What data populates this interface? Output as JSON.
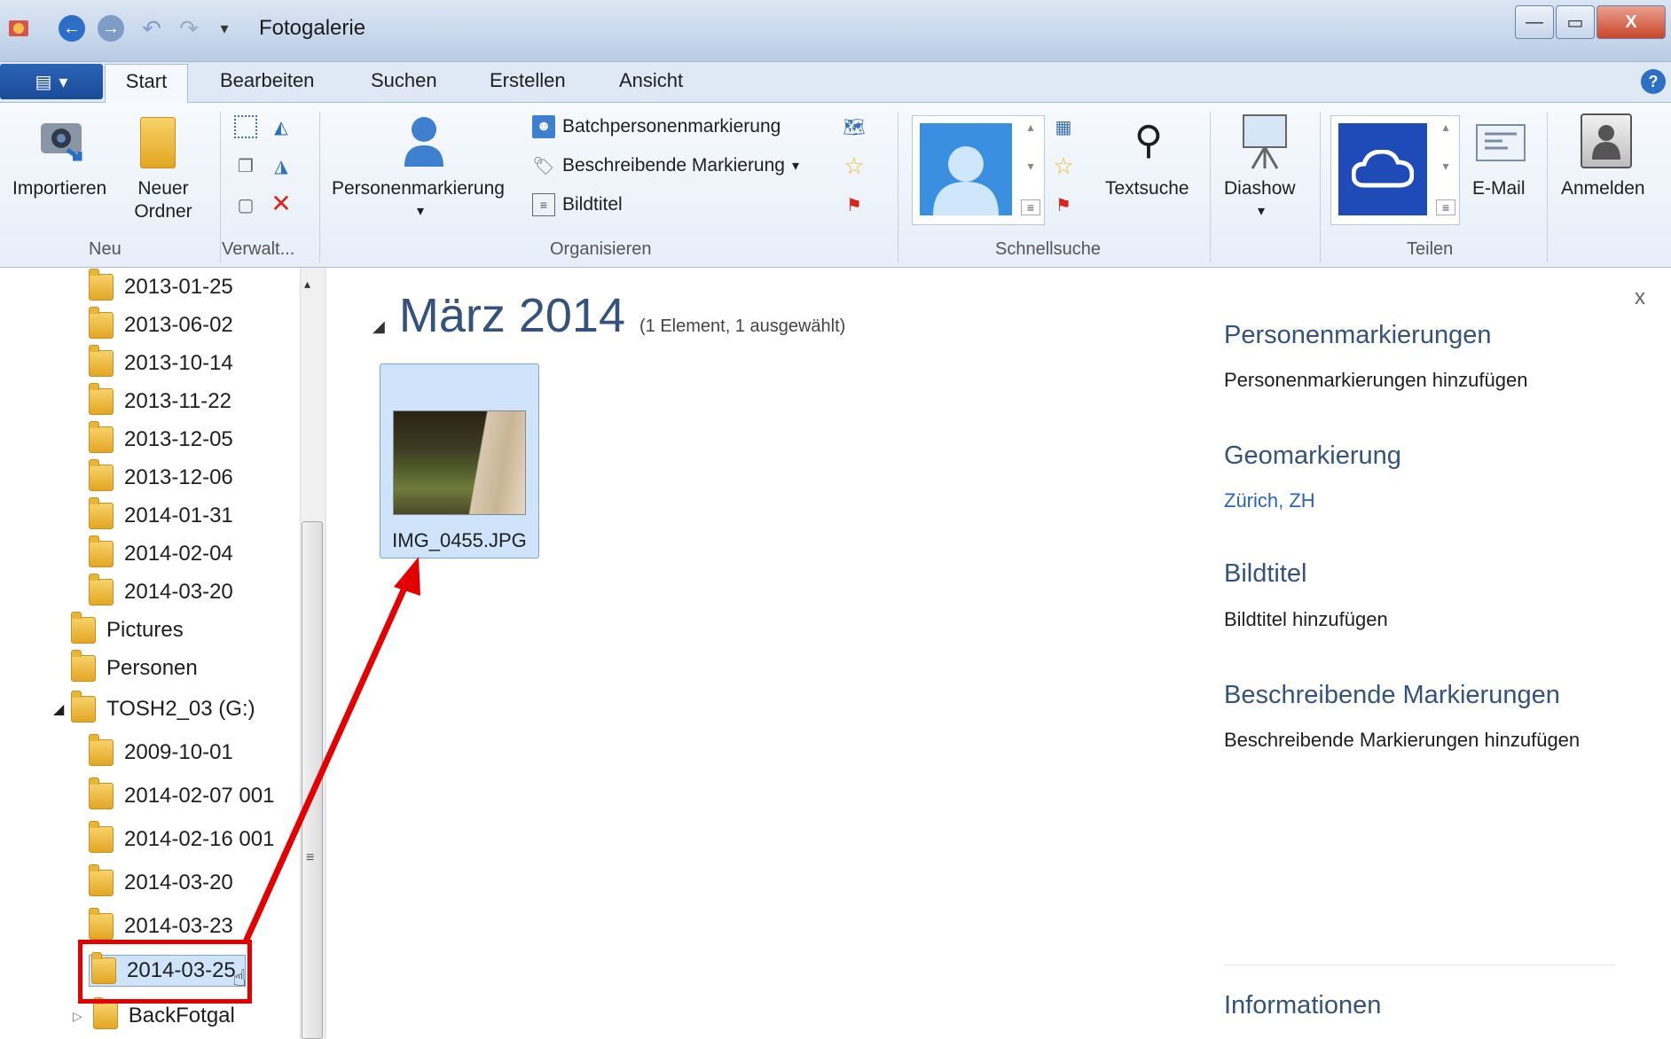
{
  "window": {
    "title": "Fotogalerie",
    "controls": {
      "minimize": "—",
      "maximize": "▭",
      "close": "X"
    }
  },
  "ribbon": {
    "app_menu_icon": "app-menu-icon",
    "tabs": [
      "Start",
      "Bearbeiten",
      "Suchen",
      "Erstellen",
      "Ansicht"
    ],
    "active_tab": "Start",
    "groups": {
      "neu": {
        "label": "Neu",
        "importieren": "Importieren",
        "neuer_ordner_1": "Neuer",
        "neuer_ordner_2": "Ordner"
      },
      "verwalten": {
        "label": "Verwalt..."
      },
      "organisieren": {
        "label": "Organisieren",
        "personenmarkierung": "Personenmarkierung",
        "batch": "Batchpersonenmarkierung",
        "beschreibende": "Beschreibende Markierung",
        "bildtitel": "Bildtitel"
      },
      "schnellsuche": {
        "label": "Schnellsuche",
        "textsuche": "Textsuche"
      },
      "diashow": {
        "label": "Diashow"
      },
      "teilen": {
        "label": "Teilen",
        "email": "E-Mail"
      },
      "anmelden": {
        "label": "Anmelden"
      }
    }
  },
  "tree": {
    "items": [
      "2013-01-25",
      "2013-06-02",
      "2013-10-14",
      "2013-11-22",
      "2013-12-05",
      "2013-12-06",
      "2014-01-31",
      "2014-02-04",
      "2014-03-20",
      "Pictures",
      "Personen",
      "TOSH2_03 (G:)",
      "2009-10-01",
      "2014-02-07 001",
      "2014-02-16 001",
      "2014-03-20",
      "2014-03-23",
      "2014-03-25",
      "BackFotgal"
    ]
  },
  "main": {
    "group_title": "März 2014",
    "group_count": "(1 Element, 1 ausgewählt)",
    "photo": {
      "name": "IMG_0455.JPG"
    }
  },
  "info_pane": {
    "close": "x",
    "personen_head": "Personenmarkierungen",
    "personen_sub": "Personenmarkierungen hinzufügen",
    "geo_head": "Geomarkierung",
    "geo_value": "Zürich, ZH",
    "bildtitel_head": "Bildtitel",
    "bildtitel_sub": "Bildtitel hinzufügen",
    "beschr_head": "Beschreibende Markierungen",
    "beschr_sub": "Beschreibende Markierungen hinzufügen",
    "info_head": "Informationen"
  },
  "colors": {
    "accent": "#34527a",
    "selection": "#cfe3fb",
    "annotation": "#e50000"
  }
}
